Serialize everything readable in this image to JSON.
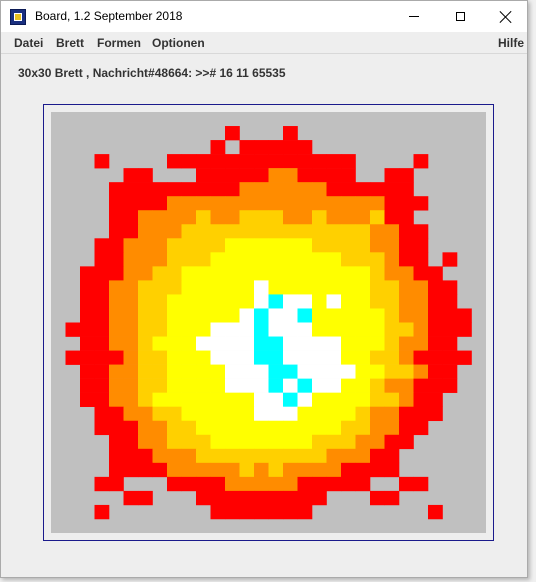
{
  "window": {
    "title": "Board, 1.2 September 2018"
  },
  "menu": {
    "items": [
      "Datei",
      "Brett",
      "Formen",
      "Optionen"
    ],
    "help": "Hilfe"
  },
  "status": {
    "message": "30x30 Brett , Nachricht#48664: >># 16 11 65535"
  },
  "colors": {
    "board_background": "#c0c0c0",
    "red": "#ff0000",
    "orange": "#ff8c00",
    "gold": "#ffd000",
    "yellow": "#ffff00",
    "white": "#ffffff",
    "cyan": "#00ffff"
  },
  "board": {
    "rows": 30,
    "cols": 30,
    "legend": {
      ".": "board_background",
      "R": "red",
      "O": "orange",
      "G": "gold",
      "Y": "yellow",
      "W": "white",
      "C": "cyan"
    },
    "cells": [
      "..............................",
      "............R...R.............",
      "...........R.RRRRR............",
      "...R....RRRRRRRRRRRRR....R.....",
      ".....RR...RRRRROORRRR..RR.....",
      "....RRRRRRRRROOOOOORRRRRR.....",
      "....RRRROOOOOOOOOOOOOOORRR....",
      "....RROOOOGOOGGGOOGOOOGRR.....",
      "....RROOOGGGGGGGGGGGGGOORR....",
      "...RROOOGGGGYYYYYYGGGGOORR....",
      "...RROOOGGGYYYYYYYYYGGGORR.R..",
      "..RRROOGGYYYYYYYYYYYYYGOORR...",
      "..RROOGGGYYYYYWYYYYYYYGGOORR..",
      "..RROOGGYYYYYYWCWWYWYYGGOORR..",
      "..RROOGGYYYYYWCWWCYYYYYGOORRR.",
      ".RRROOGGYYYWWWCWWWYYYYYGGORRR.",
      "..RROOGYYYWWWWCCWWWWYYYGOORR..",
      ".RRRROGGYYYWWWCCWWWWYYGGORRRR.",
      "..RROOGGYYYYWWWCCWWWWYYGGORR..",
      "..RROOGGYYYYWWWCWCWWYYGOORRR..",
      "..RROOGYYYYYYYWWCWYYYYGGORR...",
      "...RROOGGYYYYYWWWYYYYGOORRR...",
      "...RRROOGGYYYYYYYYYYGGOORR....",
      "....RROOGGGYYYYYYYGGGOORR.....",
      "....RRROOOGGGGGGGGGOOORR......",
      "....RRRROOOOOGOGOOOORRRR......",
      "...RR...RRRROOOOORRRRR..RR....",
      ".....RR...RRRRRRRRR...RR......",
      "...R.......RRRRRRR........R...",
      ".............................."
    ]
  }
}
